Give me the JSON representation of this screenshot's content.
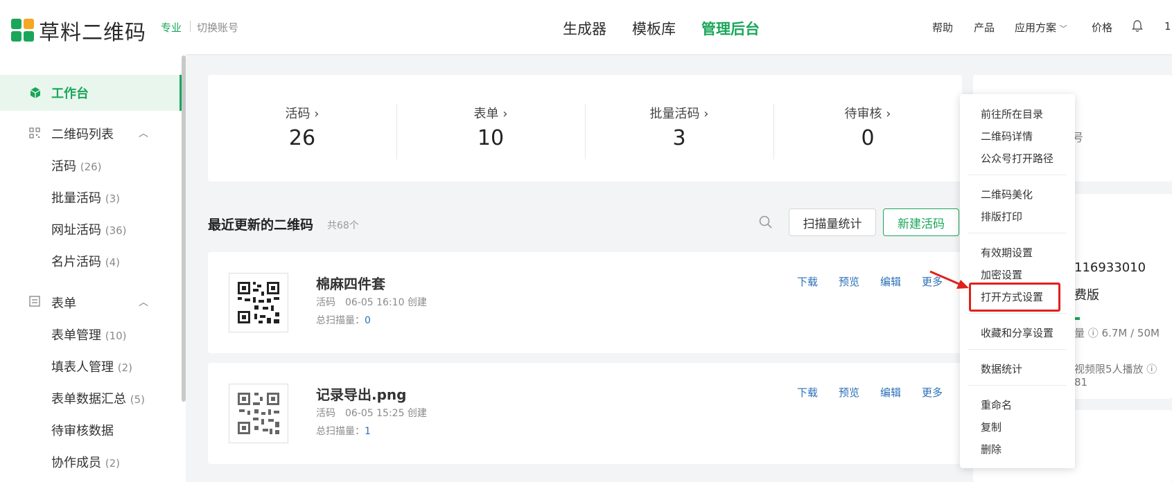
{
  "header": {
    "logo_text": "草料二维码",
    "plan": "专业",
    "switch_account": "切换账号",
    "nav": [
      "生成器",
      "模板库",
      "管理后台"
    ],
    "right": [
      "帮助",
      "产品",
      "应用方案",
      "价格"
    ],
    "user_fragment": "1"
  },
  "sidebar": {
    "workbench": "工作台",
    "group_qr": "二维码列表",
    "items_qr": [
      {
        "label": "活码",
        "count": "(26)"
      },
      {
        "label": "批量活码",
        "count": "(3)"
      },
      {
        "label": "网址活码",
        "count": "(36)"
      },
      {
        "label": "名片活码",
        "count": "(4)"
      }
    ],
    "group_form": "表单",
    "items_form": [
      {
        "label": "表单管理",
        "count": "(10)"
      },
      {
        "label": "填表人管理",
        "count": "(2)"
      },
      {
        "label": "表单数据汇总",
        "count": "(5)"
      },
      {
        "label": "待审核数据",
        "count": ""
      },
      {
        "label": "协作成员",
        "count": "(2)"
      }
    ]
  },
  "stats": [
    {
      "label": "活码 ›",
      "value": "26"
    },
    {
      "label": "表单 ›",
      "value": "10"
    },
    {
      "label": "批量活码 ›",
      "value": "3"
    },
    {
      "label": "待审核 ›",
      "value": "0"
    }
  ],
  "recent": {
    "title": "最近更新的二维码",
    "count": "共68个",
    "btn_stats": "扫描量统计",
    "btn_new": "新建活码"
  },
  "qr_items": [
    {
      "name": "棉麻四件套",
      "meta": "活码　06-05 16:10 创建",
      "scan_label": "总扫描量：",
      "scan_value": "0"
    },
    {
      "name": "记录导出.png",
      "meta": "活码　06-05 15:25 创建",
      "scan_label": "总扫描量：",
      "scan_value": "1"
    }
  ],
  "qr_actions": [
    "下载",
    "预览",
    "编辑",
    "更多"
  ],
  "right_card": {
    "frag_hao": "号",
    "phone": "116933010",
    "edition": "费版",
    "storage": "量 ⓘ 6.7M / 50M",
    "video": "视频限5人播放 ⓘ 81"
  },
  "menu": {
    "items": [
      "前往所在目录",
      "二维码详情",
      "公众号打开路径",
      "二维码美化",
      "排版打印",
      "有效期设置",
      "加密设置",
      "打开方式设置",
      "收藏和分享设置",
      "数据统计",
      "重命名",
      "复制",
      "删除"
    ]
  },
  "colors": {
    "brand": "#1aa65a",
    "link": "#2a6fb8",
    "highlight": "#e0201b"
  }
}
